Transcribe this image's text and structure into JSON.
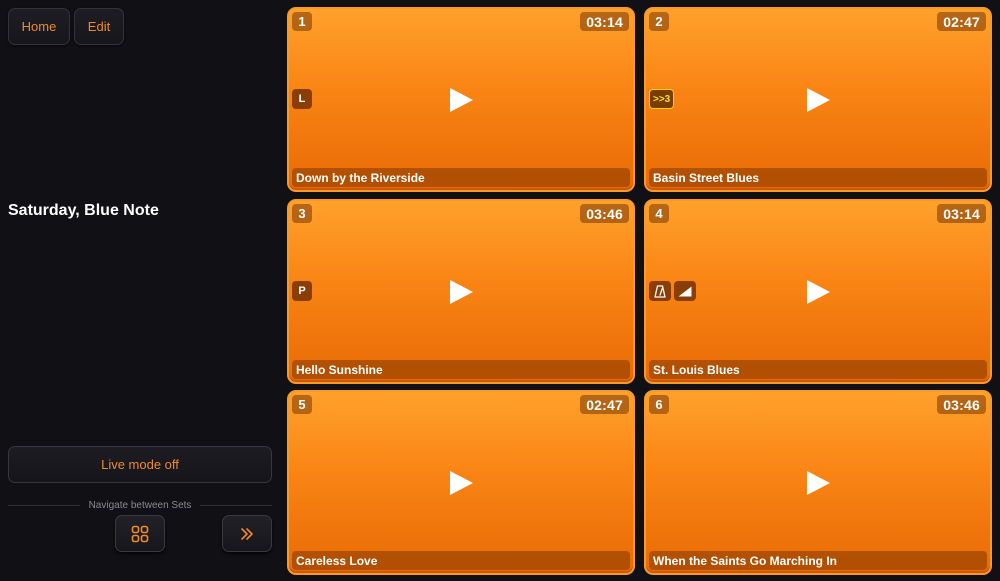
{
  "header": {
    "home_label": "Home",
    "edit_label": "Edit"
  },
  "set": {
    "title": "Saturday, Blue Note"
  },
  "live_mode": {
    "label": "Live mode off"
  },
  "navigation": {
    "label": "Navigate between Sets",
    "grid_icon": "grid-icon",
    "next_icon": "double-chevron-right-icon"
  },
  "colors": {
    "accent": "#f08a2c",
    "card_top": "#ffa12b",
    "card_bottom": "#e96b05",
    "background": "#111015"
  },
  "songs": [
    {
      "number": "1",
      "duration": "03:14",
      "title": "Down by the Riverside",
      "tags": [
        "L"
      ]
    },
    {
      "number": "2",
      "duration": "02:47",
      "title": "Basin Street Blues",
      "tags": [
        ">>3"
      ]
    },
    {
      "number": "3",
      "duration": "03:46",
      "title": "Hello Sunshine",
      "tags": [
        "P"
      ]
    },
    {
      "number": "4",
      "duration": "03:14",
      "title": "St. Louis Blues",
      "tags": [
        "metronome-icon",
        "volume-ramp-icon"
      ]
    },
    {
      "number": "5",
      "duration": "02:47",
      "title": "Careless Love",
      "tags": []
    },
    {
      "number": "6",
      "duration": "03:46",
      "title": "When the Saints Go Marching In",
      "tags": []
    }
  ]
}
